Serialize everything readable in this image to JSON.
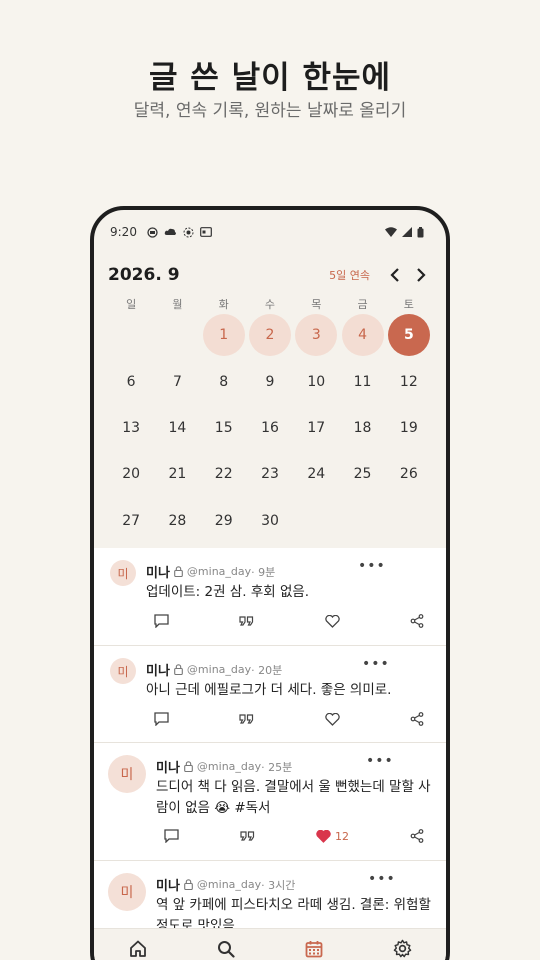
{
  "hero": {
    "title": "글 쓴 날이 한눈에",
    "subtitle": "달력, 연속 기록, 원하는 날짜로 올리기"
  },
  "status_bar": {
    "time": "9:20"
  },
  "calendar": {
    "month_label": "2026. 9",
    "streak_label": "5일 연속",
    "weekdays": [
      "일",
      "월",
      "화",
      "수",
      "목",
      "금",
      "토"
    ],
    "leading_blank_days": 2,
    "days": [
      "1",
      "2",
      "3",
      "4",
      "5",
      "6",
      "7",
      "8",
      "9",
      "10",
      "11",
      "12",
      "13",
      "14",
      "15",
      "16",
      "17",
      "18",
      "19",
      "20",
      "21",
      "22",
      "23",
      "24",
      "25",
      "26",
      "27",
      "28",
      "29",
      "30"
    ],
    "written_days": [
      1,
      2,
      3,
      4
    ],
    "today": 5,
    "accent_color": "#c9684f",
    "highlight_color": "#f3ddd3"
  },
  "feed": {
    "posts": [
      {
        "avatar": "미",
        "name": "미나",
        "handle": "@mina_day",
        "time": "· 9분",
        "lines": [
          "업데이트: 2권 삼. 후회 없음."
        ],
        "likes": ""
      },
      {
        "avatar": "미",
        "name": "미나",
        "handle": "@mina_day",
        "time": "· 20분",
        "lines": [
          "아니 근데 에필로그가 더 세다. 좋은 의미로."
        ],
        "likes": ""
      },
      {
        "avatar": "미",
        "name": "미나",
        "handle": "@mina_day",
        "time": "· 25분",
        "lines": [
          "드디어 책 다 읽음. 결말에서 울 뻔했는데 말할 사",
          "람이 없음 😭 #독서"
        ],
        "likes": "12",
        "liked": true
      },
      {
        "avatar": "미",
        "name": "미나",
        "handle": "@mina_day",
        "time": "· 3시간",
        "lines": [
          "역 앞 카페에 피스타치오 라떼 생김. 결론: 위험할",
          "정도로 맛있음."
        ],
        "likes": ""
      }
    ]
  },
  "icons": {
    "home": "home-icon",
    "search": "search-icon",
    "calendar": "calendar-icon",
    "settings": "gear-icon",
    "reply": "comment-icon",
    "quote": "quote-icon",
    "like": "heart-icon",
    "share": "share-icon"
  }
}
